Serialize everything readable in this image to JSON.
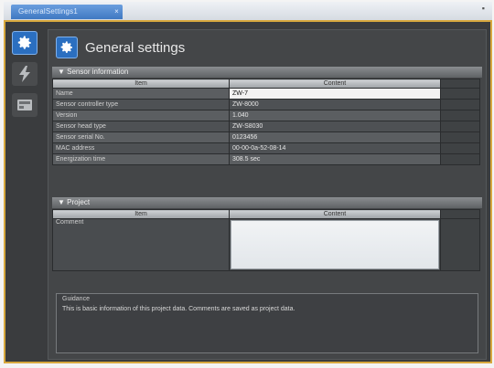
{
  "window": {
    "tab_label": "GeneralSettings1",
    "tab_close": "×",
    "corner_button": "▪"
  },
  "sidebar": {
    "items": [
      {
        "name": "general-settings",
        "icon": "gear-icon",
        "active": true
      },
      {
        "name": "sensor",
        "icon": "lightning-icon",
        "active": false
      },
      {
        "name": "controller",
        "icon": "device-icon",
        "active": false
      }
    ]
  },
  "header": {
    "title": "General settings",
    "icon": "gear-icon"
  },
  "sensor_info": {
    "section_label": "▼ Sensor information",
    "col_item": "Item",
    "col_content": "Content",
    "rows": [
      {
        "item": "Name",
        "content": "ZW-7",
        "editable": true
      },
      {
        "item": "Sensor controller type",
        "content": "ZW-8000",
        "editable": false
      },
      {
        "item": "Version",
        "content": "1.040",
        "editable": false
      },
      {
        "item": "Sensor head type",
        "content": "ZW-S8030",
        "editable": false
      },
      {
        "item": "Sensor serial No.",
        "content": "0123456",
        "editable": false
      },
      {
        "item": "MAC address",
        "content": "00-00-0a-52-08-14",
        "editable": false
      },
      {
        "item": "Energization time",
        "content": "308.5 sec",
        "editable": false
      }
    ]
  },
  "project": {
    "section_label": "▼ Project",
    "col_item": "Item",
    "col_content": "Content",
    "rows": [
      {
        "item": "Comment",
        "content": ""
      }
    ]
  },
  "guidance": {
    "title": "Guidance",
    "text": "This is basic information of this project data. Comments are saved as project data."
  },
  "colors": {
    "accent": "#2b6fc0",
    "frame_highlight": "#d7a83e",
    "panel_bg": "#444648"
  }
}
